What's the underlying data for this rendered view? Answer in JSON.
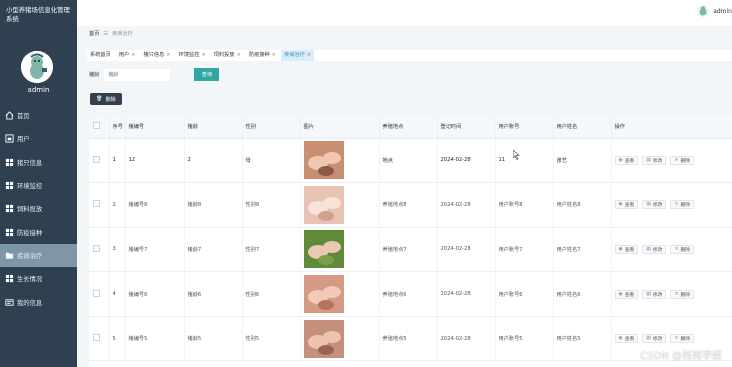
{
  "sidebar": {
    "system_title": "小型养猪场信息化管理系统",
    "user": "admin",
    "items": [
      {
        "label": "首页",
        "icon": "home-icon",
        "active": false
      },
      {
        "label": "用户",
        "icon": "user-icon",
        "active": false
      },
      {
        "label": "猪只信息",
        "icon": "grid-icon",
        "active": false
      },
      {
        "label": "环境监控",
        "icon": "grid-icon",
        "active": false
      },
      {
        "label": "饲料投放",
        "icon": "grid-icon",
        "active": false
      },
      {
        "label": "防疫接种",
        "icon": "grid-icon",
        "active": false
      },
      {
        "label": "疾病治疗",
        "icon": "folder-icon",
        "active": true
      },
      {
        "label": "生长情况",
        "icon": "grid-icon",
        "active": false
      },
      {
        "label": "我的信息",
        "icon": "user-card-icon",
        "active": false
      }
    ]
  },
  "topbar": {
    "user": "admin"
  },
  "breadcrumb": {
    "home": "首页",
    "sep": "☰",
    "current": "疾病治疗"
  },
  "tabs": [
    {
      "label": "系统首页",
      "closable": false,
      "active": false
    },
    {
      "label": "用户",
      "closable": true,
      "active": false
    },
    {
      "label": "猪只信息",
      "closable": true,
      "active": false
    },
    {
      "label": "环境监控",
      "closable": true,
      "active": false
    },
    {
      "label": "饲料投放",
      "closable": true,
      "active": false
    },
    {
      "label": "防疫接种",
      "closable": true,
      "active": false
    },
    {
      "label": "疾病治疗",
      "closable": true,
      "active": true
    }
  ],
  "search": {
    "label": "猪龄",
    "placeholder": "猪龄",
    "button": "查询"
  },
  "toolbar": {
    "delete_label": "删除"
  },
  "table": {
    "columns": [
      "序号",
      "猪编号",
      "猪龄",
      "性别",
      "图片",
      "养殖地点",
      "登记时间",
      "用户账号",
      "用户姓名",
      "操作"
    ],
    "actions": {
      "view": "查看",
      "edit": "修改",
      "delete": "删除"
    },
    "rows": [
      {
        "index": "1",
        "pig_no": "12",
        "age": "2",
        "gender": "母",
        "location": "地点",
        "time": "2024-02-28",
        "account": "11",
        "name": "张艺"
      },
      {
        "index": "2",
        "pig_no": "猪编号8",
        "age": "猪龄8",
        "gender": "性别8",
        "location": "养殖地点8",
        "time": "2024-02-28",
        "account": "用户账号8",
        "name": "用户姓名8"
      },
      {
        "index": "3",
        "pig_no": "猪编号7",
        "age": "猪龄7",
        "gender": "性别7",
        "location": "养殖地点7",
        "time": "2024-02-28",
        "account": "用户账号7",
        "name": "用户姓名7"
      },
      {
        "index": "4",
        "pig_no": "猪编号6",
        "age": "猪龄6",
        "gender": "性别6",
        "location": "养殖地点6",
        "time": "2024-02-28",
        "account": "用户账号6",
        "name": "用户姓名6"
      },
      {
        "index": "5",
        "pig_no": "猪编号5",
        "age": "猪龄5",
        "gender": "性别5",
        "location": "养殖地点5",
        "time": "2024-02-28",
        "account": "用户账号5",
        "name": "用户姓名5"
      }
    ]
  },
  "watermark": "CSDN @苑苑学姐",
  "colors": {
    "sidebar": "#2f4050",
    "active_menu": "#7f95a8",
    "search_button": "#2fa6a0",
    "content_bg": "#f2f6f9"
  }
}
